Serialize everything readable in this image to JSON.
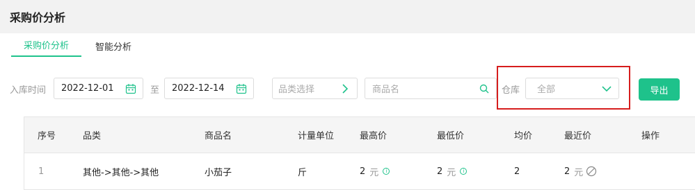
{
  "page": {
    "title": "采购价分析"
  },
  "tabs": [
    {
      "label": "采购价分析",
      "active": true
    },
    {
      "label": "智能分析",
      "active": false
    }
  ],
  "filters": {
    "date_label": "入库时间",
    "start_date": "2022-12-01",
    "to_label": "至",
    "end_date": "2022-12-14",
    "category_placeholder": "品类选择",
    "product_placeholder": "商品名",
    "warehouse_label": "仓库",
    "warehouse_value": "全部",
    "export_label": "导出"
  },
  "table": {
    "columns": [
      "序号",
      "品类",
      "商品名",
      "计量单位",
      "最高价",
      "最低价",
      "均价",
      "最近价",
      "操作"
    ],
    "rows": [
      {
        "index": "1",
        "category": "其他->其他->其他",
        "product": "小茄子",
        "unit": "斤",
        "max_price": "2",
        "max_unit": "元",
        "min_price": "2",
        "min_unit": "元",
        "avg_price": "2",
        "latest_price": "2",
        "latest_unit": "元"
      }
    ]
  },
  "colors": {
    "accent": "#1ec28b",
    "highlight": "#d61d1d"
  }
}
